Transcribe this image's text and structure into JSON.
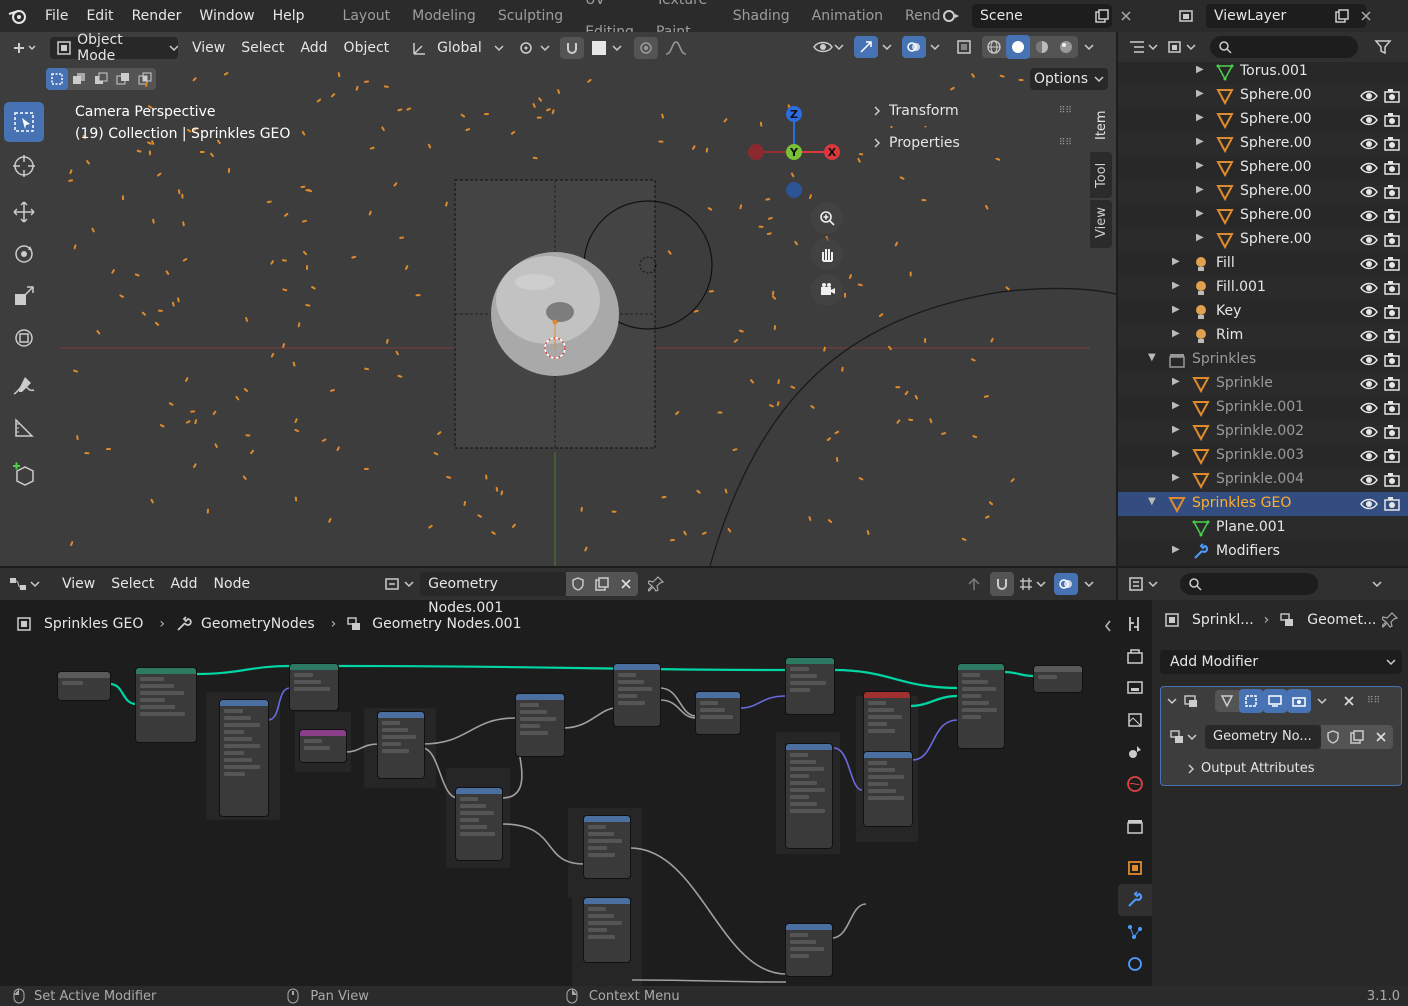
{
  "topbar": {
    "menus": [
      "File",
      "Edit",
      "Render",
      "Window",
      "Help"
    ],
    "workspaces": [
      "Layout",
      "Modeling",
      "Sculpting",
      "UV Editing",
      "Texture Paint",
      "Shading",
      "Animation",
      "Rend"
    ],
    "scene": "Scene",
    "view_layer": "ViewLayer"
  },
  "viewport_header": {
    "mode": "Object Mode",
    "menus": [
      "View",
      "Select",
      "Add",
      "Object"
    ],
    "transform_orientation": "Global",
    "options": "Options"
  },
  "viewport": {
    "title": "Camera Perspective",
    "subtitle": "(19) Collection | Sprinkles GEO",
    "npanel": {
      "transform": "Transform",
      "properties": "Properties"
    },
    "side_tabs": [
      "Item",
      "Tool",
      "View"
    ],
    "gizmo": {
      "z": "Z",
      "y": "Y",
      "x": "X"
    }
  },
  "outliner": {
    "rows": [
      {
        "name": "Torus.001",
        "kind": "mesh-data",
        "indent": 3,
        "state": "normal",
        "vis": false
      },
      {
        "name": "Sphere.00",
        "kind": "mesh",
        "indent": 3,
        "state": "normal",
        "vis": true
      },
      {
        "name": "Sphere.00",
        "kind": "mesh",
        "indent": 3,
        "state": "normal",
        "vis": true
      },
      {
        "name": "Sphere.00",
        "kind": "mesh",
        "indent": 3,
        "state": "normal",
        "vis": true
      },
      {
        "name": "Sphere.00",
        "kind": "mesh",
        "indent": 3,
        "state": "normal",
        "vis": true
      },
      {
        "name": "Sphere.00",
        "kind": "mesh",
        "indent": 3,
        "state": "normal",
        "vis": true
      },
      {
        "name": "Sphere.00",
        "kind": "mesh",
        "indent": 3,
        "state": "normal",
        "vis": true
      },
      {
        "name": "Sphere.00",
        "kind": "mesh",
        "indent": 3,
        "state": "normal",
        "vis": true
      },
      {
        "name": "Fill",
        "kind": "light",
        "indent": 2,
        "state": "normal",
        "vis": true
      },
      {
        "name": "Fill.001",
        "kind": "light",
        "indent": 2,
        "state": "normal",
        "vis": true
      },
      {
        "name": "Key",
        "kind": "light",
        "indent": 2,
        "state": "normal",
        "vis": true
      },
      {
        "name": "Rim",
        "kind": "light",
        "indent": 2,
        "state": "normal",
        "vis": true
      },
      {
        "name": "Sprinkles",
        "kind": "collection",
        "indent": 1,
        "state": "dim",
        "vis": true
      },
      {
        "name": "Sprinkle",
        "kind": "mesh",
        "indent": 2,
        "state": "dim",
        "vis": true
      },
      {
        "name": "Sprinkle.001",
        "kind": "mesh",
        "indent": 2,
        "state": "dim",
        "vis": true
      },
      {
        "name": "Sprinkle.002",
        "kind": "mesh",
        "indent": 2,
        "state": "dim",
        "vis": true
      },
      {
        "name": "Sprinkle.003",
        "kind": "mesh",
        "indent": 2,
        "state": "dim",
        "vis": true
      },
      {
        "name": "Sprinkle.004",
        "kind": "mesh",
        "indent": 2,
        "state": "dim",
        "vis": true
      },
      {
        "name": "Sprinkles GEO",
        "kind": "mesh",
        "indent": 1,
        "state": "selected",
        "vis": true
      },
      {
        "name": "Plane.001",
        "kind": "mesh-data",
        "indent": 2,
        "state": "normal",
        "vis": false
      },
      {
        "name": "Modifiers",
        "kind": "wrench",
        "indent": 2,
        "state": "normal",
        "vis": false
      }
    ]
  },
  "node_editor": {
    "menus": [
      "View",
      "Select",
      "Add",
      "Node"
    ],
    "tree_name": "Geometry Nodes.001",
    "breadcrumb": [
      "Sprinkles GEO",
      "GeometryNodes",
      "Geometry Nodes.001"
    ]
  },
  "properties": {
    "breadcrumb": [
      "Sprinkl...",
      "Geomet..."
    ],
    "add_modifier": "Add Modifier",
    "modifier_tree": "Geometry No...",
    "output_attributes": "Output Attributes"
  },
  "statusbar": {
    "items": [
      "Set Active Modifier",
      "Pan View",
      "Context Menu"
    ],
    "version": "3.1.0"
  },
  "colors": {
    "accent": "#4772b3",
    "selected_object": "#ffaf29",
    "sprinkle": "#e08a2e",
    "geometry_link": "#00d6a3"
  }
}
